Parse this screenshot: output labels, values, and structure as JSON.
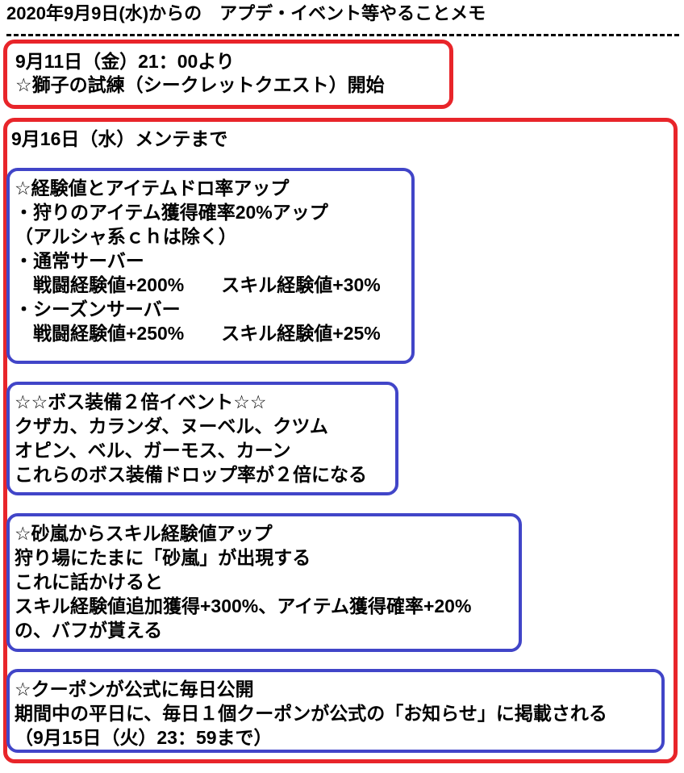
{
  "document": {
    "title": "2020年9月9日(水)からの　アプデ・イベント等やることメモ",
    "separator": "dashed-rule"
  },
  "colors": {
    "red_border": "#e8252a",
    "blue_border": "#4145c8",
    "text": "#000000",
    "background": "#ffffff"
  },
  "sections": [
    {
      "id": "lion-trial",
      "border_color": "red",
      "lines": [
        "9月11日（金）21：00より",
        "☆獅子の試練（シークレットクエスト）開始"
      ]
    },
    {
      "id": "until-maintenance",
      "border_color": "red",
      "heading": "9月16日（水）メンテまで",
      "subsections": [
        {
          "id": "exp-and-item-drop-up",
          "border_color": "blue",
          "lines": [
            "☆経験値とアイテムドロ率アップ",
            "・狩りのアイテム獲得確率20%アップ",
            "（アルシャ系ｃｈは除く）",
            "・通常サーバー",
            "　戦闘経験値+200%　　スキル経験値+30%",
            "・シーズンサーバー",
            "　戦闘経験値+250%　　スキル経験値+25%"
          ]
        },
        {
          "id": "boss-gear-double",
          "border_color": "blue",
          "lines": [
            "☆☆ボス装備２倍イベント☆☆",
            "クザカ、カランダ、ヌーベル、クツム",
            "オピン、ベル、ガーモス、カーン",
            "これらのボス装備ドロップ率が２倍になる"
          ]
        },
        {
          "id": "sandstorm-skill-exp",
          "border_color": "blue",
          "lines": [
            "☆砂嵐からスキル経験値アップ",
            "狩り場にたまに「砂嵐」が出現する",
            "これに話かけると",
            "スキル経験値追加獲得+300%、アイテム獲得確率+20%",
            "の、バフが貰える"
          ]
        },
        {
          "id": "daily-coupon",
          "border_color": "blue",
          "lines": [
            "☆クーポンが公式に毎日公開",
            "期間中の平日に、毎日１個クーポンが公式の「お知らせ」に掲載される",
            "（9月15日（火）23：59まで）"
          ]
        }
      ]
    }
  ]
}
